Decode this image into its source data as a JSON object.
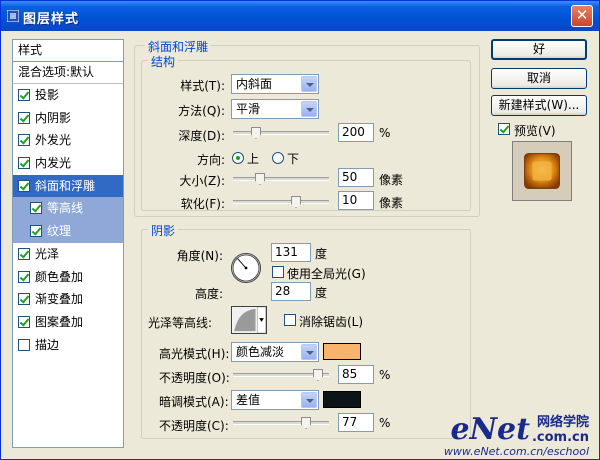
{
  "window": {
    "title": "图层样式"
  },
  "styles_list": {
    "header": "样式",
    "blend_default": "混合选项:默认",
    "items": [
      {
        "label": "投影",
        "checked": true,
        "state": "normal"
      },
      {
        "label": "内阴影",
        "checked": true,
        "state": "normal"
      },
      {
        "label": "外发光",
        "checked": true,
        "state": "normal"
      },
      {
        "label": "内发光",
        "checked": true,
        "state": "normal"
      },
      {
        "label": "斜面和浮雕",
        "checked": true,
        "state": "selected"
      },
      {
        "label": "等高线",
        "checked": true,
        "state": "sub"
      },
      {
        "label": "纹理",
        "checked": true,
        "state": "sub"
      },
      {
        "label": "光泽",
        "checked": true,
        "state": "normal"
      },
      {
        "label": "颜色叠加",
        "checked": true,
        "state": "normal"
      },
      {
        "label": "渐变叠加",
        "checked": true,
        "state": "normal"
      },
      {
        "label": "图案叠加",
        "checked": true,
        "state": "normal"
      },
      {
        "label": "描边",
        "checked": false,
        "state": "normal"
      }
    ]
  },
  "bevel": {
    "group_title": "斜面和浮雕",
    "structure": {
      "title": "结构",
      "style_label": "样式(T):",
      "style_value": "内斜面",
      "technique_label": "方法(Q):",
      "technique_value": "平滑",
      "depth_label": "深度(D):",
      "depth_value": "200",
      "depth_unit": "%",
      "direction_label": "方向:",
      "direction_up": "上",
      "direction_down": "下",
      "size_label": "大小(Z):",
      "size_value": "50",
      "size_unit": "像素",
      "soften_label": "软化(F):",
      "soften_value": "10",
      "soften_unit": "像素"
    },
    "shading": {
      "title": "阴影",
      "angle_label": "角度(N):",
      "angle_value": "131",
      "angle_unit": "度",
      "global_light_label": "使用全局光(G)",
      "altitude_label": "高度:",
      "altitude_value": "28",
      "altitude_unit": "度",
      "gloss_contour_label": "光泽等高线:",
      "anti_aliased_label": "消除锯齿(L)",
      "highlight_mode_label": "高光模式(H):",
      "highlight_mode_value": "颜色减淡",
      "highlight_color": "#f7b46a",
      "opacity1_label": "不透明度(O):",
      "opacity1_value": "85",
      "opacity_unit": "%",
      "shadow_mode_label": "暗调模式(A):",
      "shadow_mode_value": "差值",
      "shadow_color": "#0d1418",
      "opacity2_label": "不透明度(C):",
      "opacity2_value": "77"
    }
  },
  "buttons": {
    "ok": "好",
    "cancel": "取消",
    "new_style": "新建样式(W)...",
    "preview_label": "预览(V)"
  },
  "watermark": {
    "logo": "eNet",
    "logo_cn": "网络学院",
    "domain": ".com.cn",
    "url": "www.eNet.com.cn/eschool"
  }
}
